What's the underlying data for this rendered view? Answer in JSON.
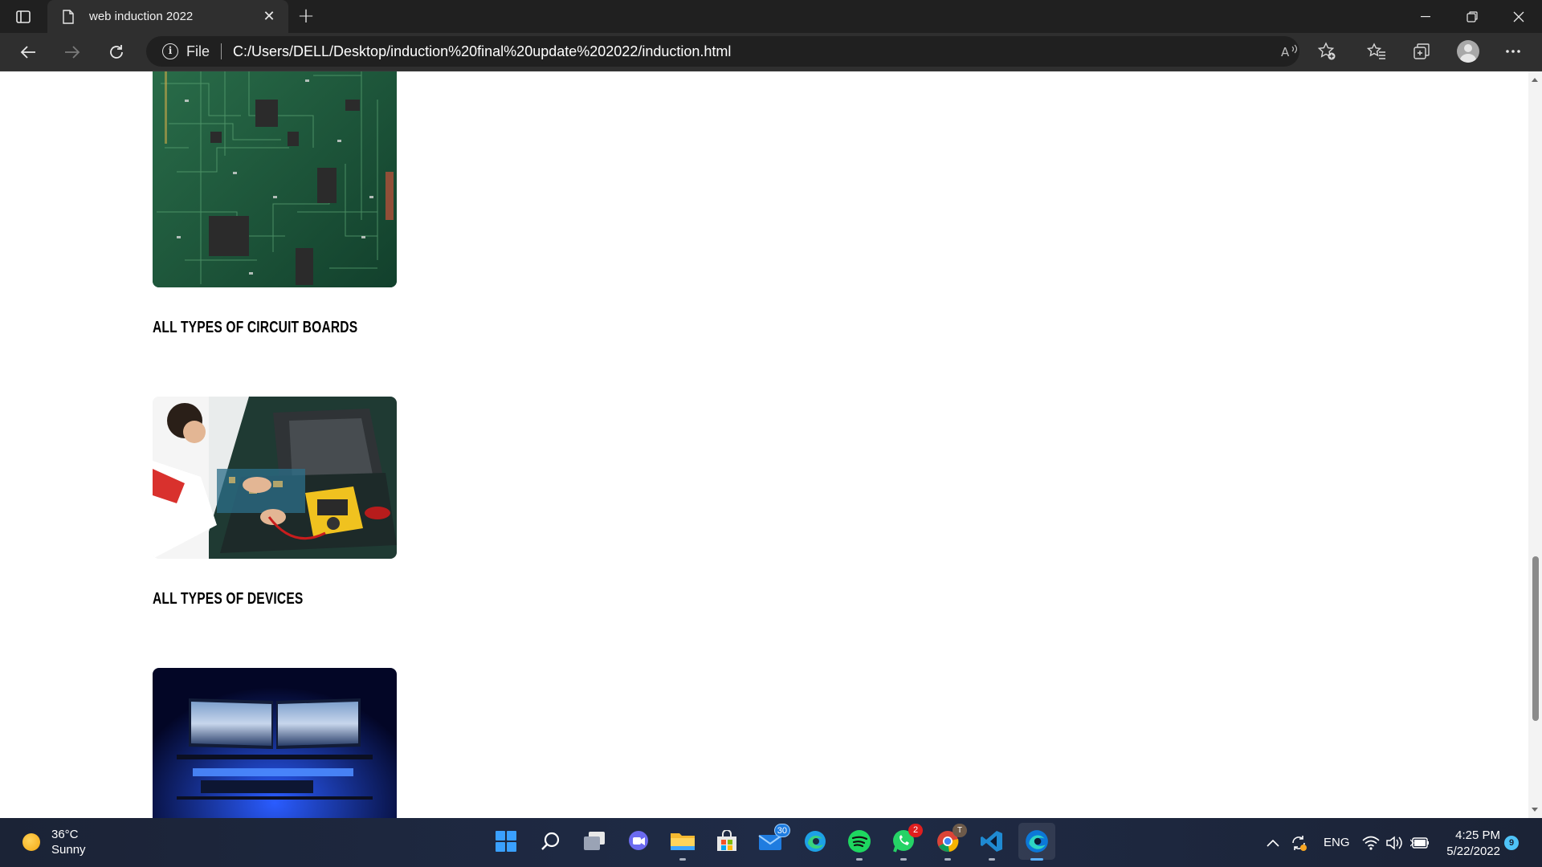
{
  "browser": {
    "tab_title": "web induction 2022",
    "address_scheme_label": "File",
    "url": "C:/Users/DELL/Desktop/induction%20final%20update%202022/induction.html"
  },
  "page": {
    "items": [
      {
        "image": "circuit-board-photo",
        "caption": ""
      },
      {
        "image": "technician-repair-photo",
        "caption": "ALL TYPES OF CIRCUIT BOARDS"
      },
      {
        "image": "gaming-setup-photo",
        "caption": "ALL TYPES OF DEVICES"
      }
    ],
    "scroll_position_fraction": 0.67
  },
  "taskbar": {
    "weather_temp": "36°C",
    "weather_desc": "Sunny",
    "mail_badge": "30",
    "whatsapp_badge": "2",
    "chrome_badge": "T",
    "language": "ENG",
    "time": "4:25 PM",
    "date": "5/22/2022",
    "notification_count": "9",
    "apps": [
      "start",
      "search",
      "task-view",
      "chat",
      "file-explorer",
      "store",
      "mail",
      "edge",
      "spotify",
      "whatsapp",
      "chrome",
      "vscode",
      "edge-dev"
    ]
  },
  "colors": {
    "titlebar": "#202020",
    "toolbar": "#2f2f2f",
    "taskbar": "#1f2b46",
    "accent": "#0078d4"
  }
}
